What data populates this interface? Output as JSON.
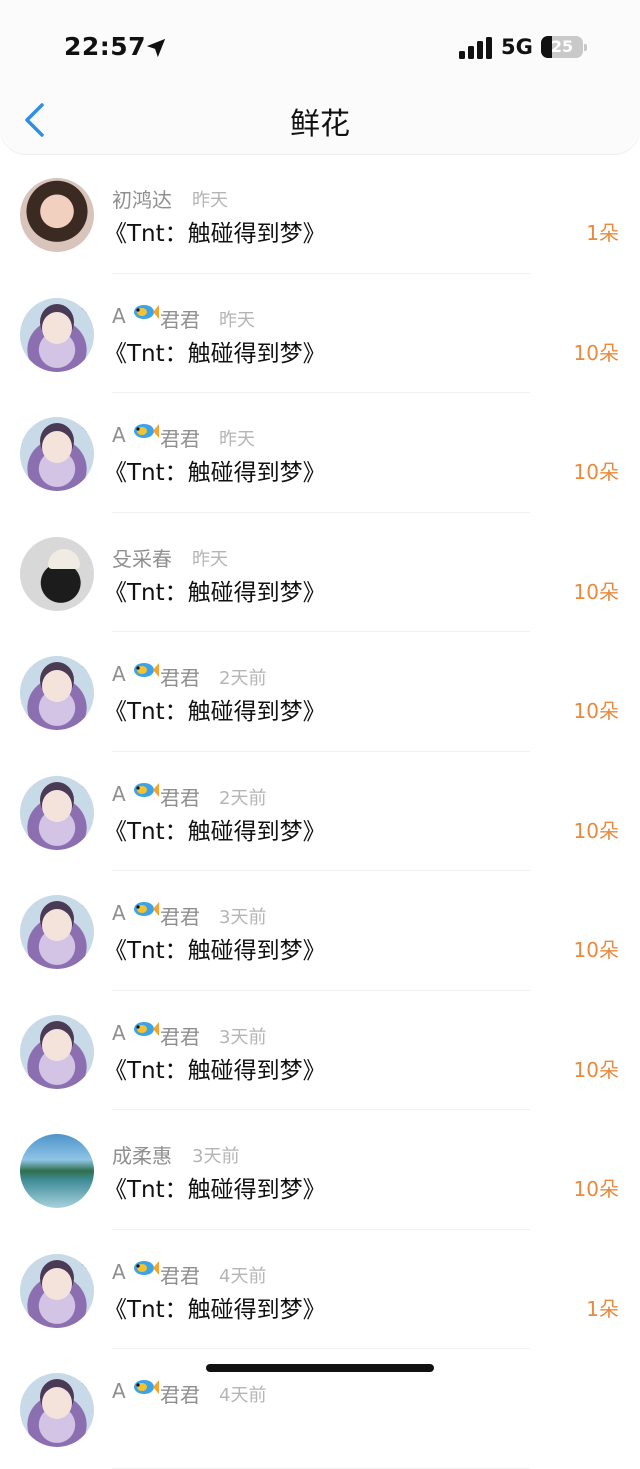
{
  "status_bar": {
    "time": "22:57",
    "network": "5G",
    "battery": "25",
    "battery_level": 0.25
  },
  "header": {
    "title": "鲜花"
  },
  "items": [
    {
      "prefix": "",
      "name": "初鸿达",
      "ago": "昨天",
      "book": "《Tnt：触碰得到梦》",
      "count": "1朵",
      "avatar": "girl"
    },
    {
      "prefix": "A",
      "name": "君君",
      "ago": "昨天",
      "book": "《Tnt：触碰得到梦》",
      "count": "10朵",
      "avatar": "anime"
    },
    {
      "prefix": "A",
      "name": "君君",
      "ago": "昨天",
      "book": "《Tnt：触碰得到梦》",
      "count": "10朵",
      "avatar": "anime"
    },
    {
      "prefix": "",
      "name": "殳采春",
      "ago": "昨天",
      "book": "《Tnt：触碰得到梦》",
      "count": "10朵",
      "avatar": "hat"
    },
    {
      "prefix": "A",
      "name": "君君",
      "ago": "2天前",
      "book": "《Tnt：触碰得到梦》",
      "count": "10朵",
      "avatar": "anime"
    },
    {
      "prefix": "A",
      "name": "君君",
      "ago": "2天前",
      "book": "《Tnt：触碰得到梦》",
      "count": "10朵",
      "avatar": "anime"
    },
    {
      "prefix": "A",
      "name": "君君",
      "ago": "3天前",
      "book": "《Tnt：触碰得到梦》",
      "count": "10朵",
      "avatar": "anime"
    },
    {
      "prefix": "A",
      "name": "君君",
      "ago": "3天前",
      "book": "《Tnt：触碰得到梦》",
      "count": "10朵",
      "avatar": "anime"
    },
    {
      "prefix": "",
      "name": "成柔惠",
      "ago": "3天前",
      "book": "《Tnt：触碰得到梦》",
      "count": "10朵",
      "avatar": "landscape"
    },
    {
      "prefix": "A",
      "name": "君君",
      "ago": "4天前",
      "book": "《Tnt：触碰得到梦》",
      "count": "1朵",
      "avatar": "anime"
    },
    {
      "prefix": "A",
      "name": "君君",
      "ago": "4天前",
      "book": "",
      "count": "",
      "avatar": "anime"
    }
  ],
  "icons": {
    "back": "chevron-left-icon",
    "location": "location-arrow-icon",
    "signal": "signal-bars-icon",
    "fish": "fish-emoji-icon"
  },
  "colors": {
    "accent": "#2F8FE0",
    "count": "#E98A3E"
  }
}
